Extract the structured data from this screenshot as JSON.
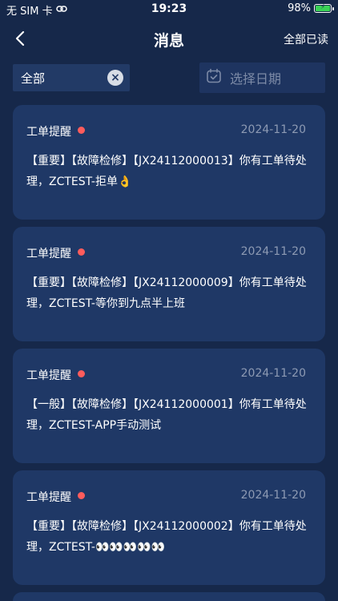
{
  "status_bar": {
    "carrier": "无 SIM 卡",
    "time": "19:23",
    "battery_percent": "98%",
    "battery_level": 0.98
  },
  "header": {
    "title": "消息",
    "read_all": "全部已读"
  },
  "filters": {
    "type_value": "全部",
    "date_placeholder": "选择日期"
  },
  "messages": [
    {
      "type": "工单提醒",
      "date": "2024-11-20",
      "text": "【重要】【故障检修】【JX24112000013】你有工单待处理，ZCTEST-拒单👌",
      "unread": true
    },
    {
      "type": "工单提醒",
      "date": "2024-11-20",
      "text": "【重要】【故障检修】【JX24112000009】你有工单待处理，ZCTEST-等你到九点半上班",
      "unread": true
    },
    {
      "type": "工单提醒",
      "date": "2024-11-20",
      "text": "【一般】【故障检修】【JX24112000001】你有工单待处理，ZCTEST-APP手动测试",
      "unread": true
    },
    {
      "type": "工单提醒",
      "date": "2024-11-20",
      "text": "【重要】【故障检修】【JX24112000002】你有工单待处理，ZCTEST-👀👀👀👀👀",
      "unread": true
    }
  ],
  "colors": {
    "background": "#16284a",
    "card": "#1f3866",
    "unread_dot": "#ff5c5c",
    "battery": "#3ad356"
  }
}
